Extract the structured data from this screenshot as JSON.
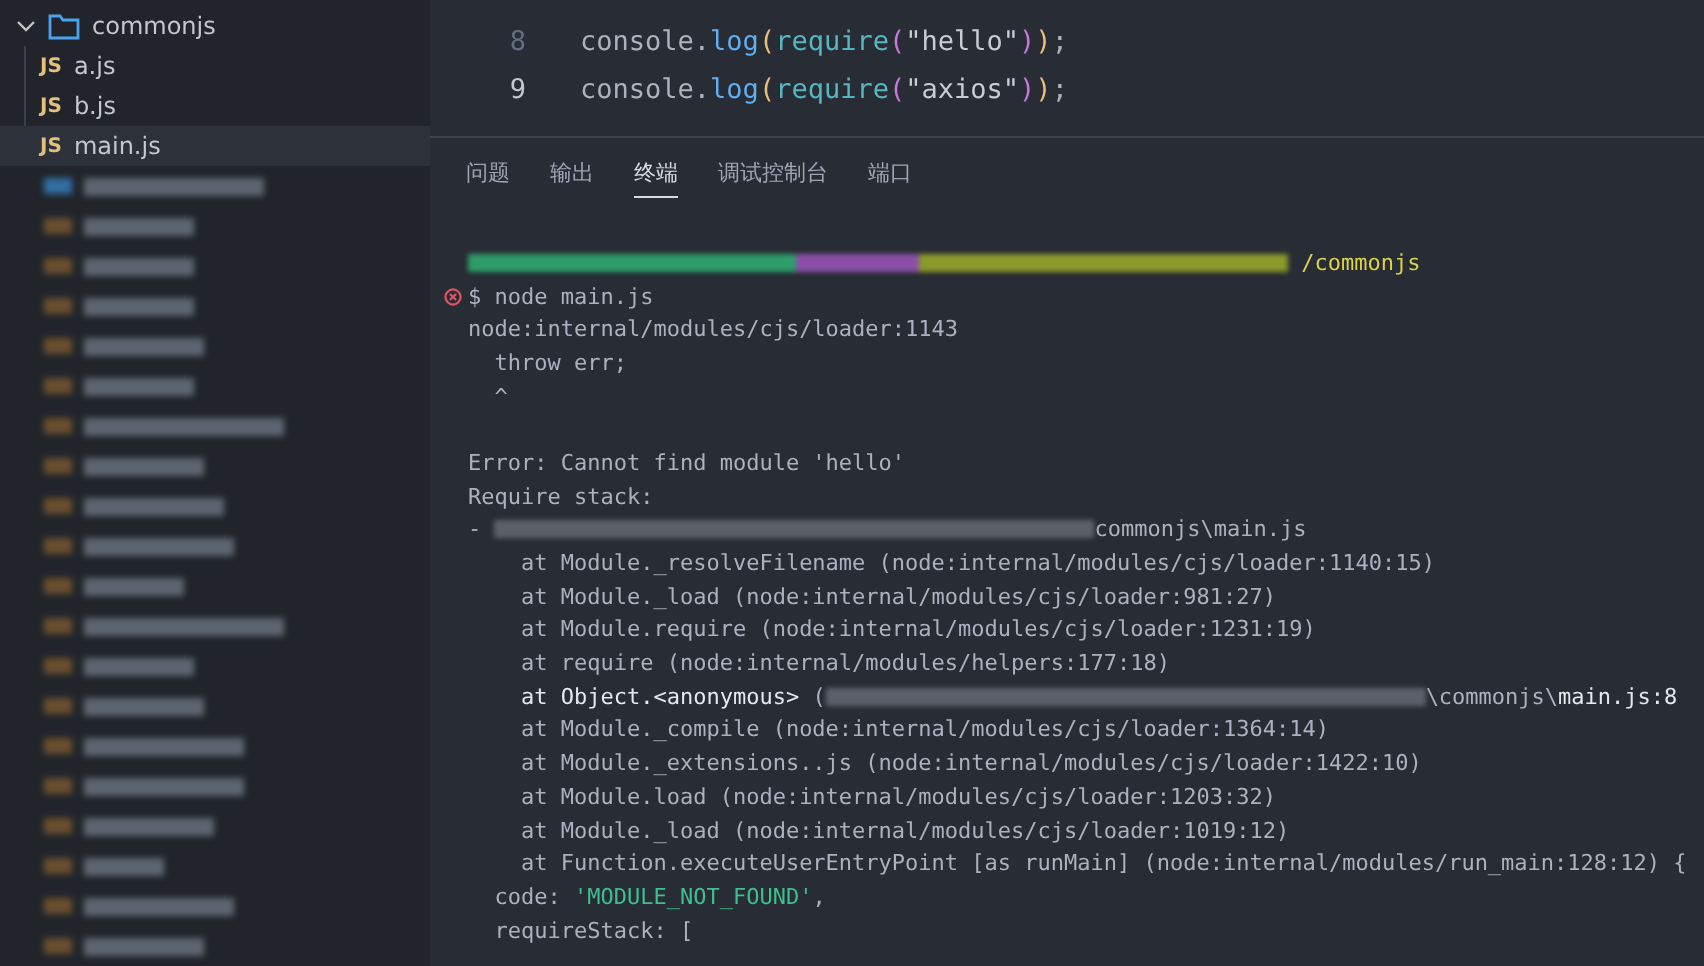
{
  "explorer": {
    "folder": {
      "name": "commonjs",
      "expanded": true,
      "children": [
        {
          "name": "a.js",
          "icon": "JS",
          "selected": false
        },
        {
          "name": "b.js",
          "icon": "JS",
          "selected": false
        },
        {
          "name": "main.js",
          "icon": "JS",
          "selected": true
        }
      ]
    }
  },
  "editor": {
    "lines": [
      {
        "number": "8",
        "current": false,
        "tokens": [
          {
            "kind": "ident",
            "text": "console"
          },
          {
            "kind": "punct",
            "text": "."
          },
          {
            "kind": "fn",
            "text": "log"
          },
          {
            "kind": "paren1",
            "text": "("
          },
          {
            "kind": "fn2",
            "text": "require"
          },
          {
            "kind": "paren2",
            "text": "("
          },
          {
            "kind": "str",
            "text": "\"hello\""
          },
          {
            "kind": "paren2",
            "text": ")"
          },
          {
            "kind": "paren1",
            "text": ")"
          },
          {
            "kind": "punct",
            "text": ";"
          }
        ]
      },
      {
        "number": "9",
        "current": true,
        "tokens": [
          {
            "kind": "ident",
            "text": "console"
          },
          {
            "kind": "punct",
            "text": "."
          },
          {
            "kind": "fn",
            "text": "log"
          },
          {
            "kind": "paren1",
            "text": "("
          },
          {
            "kind": "fn2",
            "text": "require"
          },
          {
            "kind": "paren2",
            "text": "("
          },
          {
            "kind": "str",
            "text": "\"axios\""
          },
          {
            "kind": "paren2",
            "text": ")"
          },
          {
            "kind": "paren1",
            "text": ")"
          },
          {
            "kind": "punct",
            "text": ";"
          }
        ]
      }
    ]
  },
  "panel": {
    "tabs": [
      {
        "label": "问题",
        "selected": false
      },
      {
        "label": "输出",
        "selected": false
      },
      {
        "label": "终端",
        "selected": true
      },
      {
        "label": "调试控制台",
        "selected": false
      },
      {
        "label": "端口",
        "selected": false
      }
    ],
    "terminal": {
      "lines": [
        {
          "kind": "output",
          "segments": [
            {
              "kind": "redacted_multi"
            },
            {
              "kind": "path",
              "text": " /commonjs"
            }
          ]
        },
        {
          "kind": "prompt",
          "failed": true,
          "segments": [
            {
              "kind": "text",
              "text": "$ node main.js"
            }
          ]
        },
        {
          "kind": "output",
          "segments": [
            {
              "kind": "text",
              "text": "node:internal/modules/cjs/loader:1143"
            }
          ]
        },
        {
          "kind": "output",
          "segments": [
            {
              "kind": "text",
              "text": "  throw err;"
            }
          ]
        },
        {
          "kind": "output",
          "segments": [
            {
              "kind": "text",
              "text": "  ^"
            }
          ]
        },
        {
          "kind": "blank"
        },
        {
          "kind": "output",
          "segments": [
            {
              "kind": "text",
              "text": "Error: Cannot find module 'hello'"
            }
          ]
        },
        {
          "kind": "output",
          "segments": [
            {
              "kind": "text",
              "text": "Require stack:"
            }
          ]
        },
        {
          "kind": "output",
          "segments": [
            {
              "kind": "text",
              "text": "- "
            },
            {
              "kind": "redacted_grey"
            },
            {
              "kind": "text",
              "text": "commonjs\\main.js"
            }
          ]
        },
        {
          "kind": "output",
          "segments": [
            {
              "kind": "text",
              "text": "    at Module._resolveFilename (node:internal/modules/cjs/loader:1140:15)"
            }
          ]
        },
        {
          "kind": "output",
          "segments": [
            {
              "kind": "text",
              "text": "    at Module._load (node:internal/modules/cjs/loader:981:27)"
            }
          ]
        },
        {
          "kind": "output",
          "segments": [
            {
              "kind": "text",
              "text": "    at Module.require (node:internal/modules/cjs/loader:1231:19)"
            }
          ]
        },
        {
          "kind": "output",
          "segments": [
            {
              "kind": "text",
              "text": "    at require (node:internal/modules/helpers:177:18)"
            }
          ]
        },
        {
          "kind": "output",
          "segments": [
            {
              "kind": "bright",
              "text": "    at Object.<anonymous> "
            },
            {
              "kind": "text",
              "text": "("
            },
            {
              "kind": "redacted_grey"
            },
            {
              "kind": "text",
              "text": "\\commonjs\\"
            },
            {
              "kind": "bright",
              "text": "main.js:8"
            }
          ]
        },
        {
          "kind": "output",
          "segments": [
            {
              "kind": "text",
              "text": "    at Module._compile (node:internal/modules/cjs/loader:1364:14)"
            }
          ]
        },
        {
          "kind": "output",
          "segments": [
            {
              "kind": "text",
              "text": "    at Module._extensions..js (node:internal/modules/cjs/loader:1422:10)"
            }
          ]
        },
        {
          "kind": "output",
          "segments": [
            {
              "kind": "text",
              "text": "    at Module.load (node:internal/modules/cjs/loader:1203:32)"
            }
          ]
        },
        {
          "kind": "output",
          "segments": [
            {
              "kind": "text",
              "text": "    at Module._load (node:internal/modules/cjs/loader:1019:12)"
            }
          ]
        },
        {
          "kind": "output",
          "segments": [
            {
              "kind": "text",
              "text": "    at Function.executeUserEntryPoint [as runMain] (node:internal/modules/run_main:128:12) {"
            }
          ]
        },
        {
          "kind": "output",
          "segments": [
            {
              "kind": "text",
              "text": "  code: "
            },
            {
              "kind": "string",
              "text": "'MODULE_NOT_FOUND'"
            },
            {
              "kind": "text",
              "text": ","
            }
          ]
        },
        {
          "kind": "output",
          "segments": [
            {
              "kind": "text",
              "text": "  requireStack: ["
            }
          ]
        }
      ]
    }
  }
}
